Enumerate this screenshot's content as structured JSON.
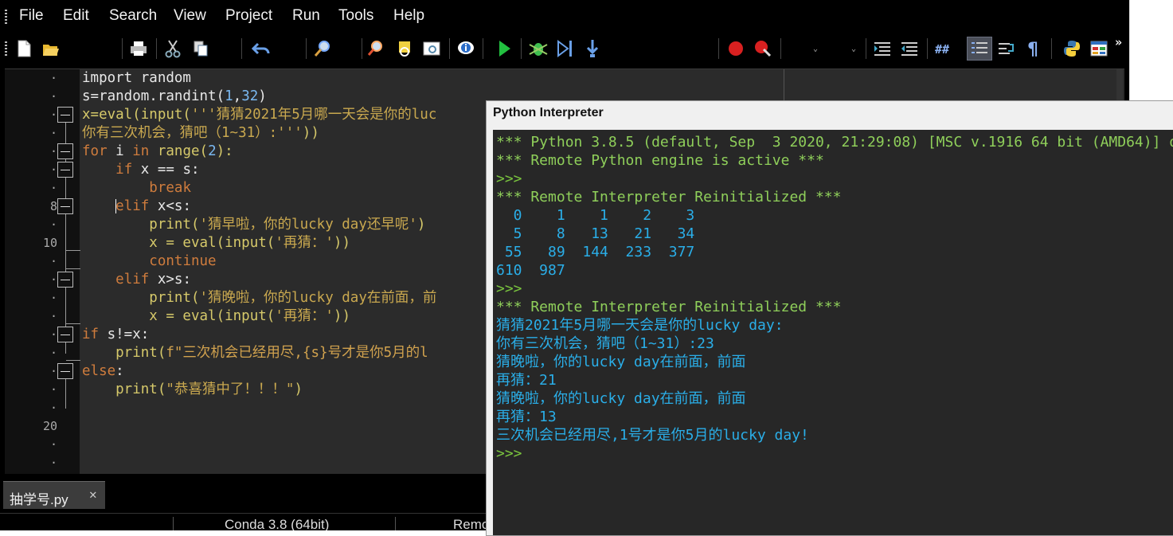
{
  "menu": [
    "File",
    "Edit",
    "Search",
    "View",
    "Project",
    "Run",
    "Tools",
    "Help"
  ],
  "toolbar": {
    "icons": [
      "new-file-icon",
      "open-file-icon",
      "print-icon",
      "cut-icon",
      "copy-icon",
      "undo-icon",
      "find-icon",
      "find-in-files-icon",
      "highlight-icon",
      "view-icon",
      "info-icon",
      "run-icon",
      "debug-icon",
      "step-icon",
      "step-into-icon",
      "breakpoint-icon",
      "clear-breakpoints-icon",
      "indent-icon",
      "dedent-icon",
      "comment-icon",
      "line-numbers-icon",
      "wrap-icon",
      "paragraph-icon",
      "python-icon",
      "layout-icon"
    ],
    "more": "»"
  },
  "editor": {
    "line_numbers": {
      "8": "8",
      "10": "10",
      "20": "20"
    },
    "code_lines": [
      [
        {
          "t": "import random",
          "c": "wht"
        }
      ],
      [
        {
          "t": "s=random.randint(",
          "c": "wht"
        },
        {
          "t": "1",
          "c": "num"
        },
        {
          "t": ",",
          "c": "wht"
        },
        {
          "t": "32",
          "c": "num"
        },
        {
          "t": ")",
          "c": "wht"
        }
      ],
      [
        {
          "t": "x=eval(input(",
          "c": "bi"
        },
        {
          "t": "'''猜猜2021年5月哪一天会是你的luc",
          "c": "str"
        }
      ],
      [
        {
          "t": "你有三次机会，猜吧（1~31）:'''",
          "c": "str"
        },
        {
          "t": "))",
          "c": "bi"
        }
      ],
      [
        {
          "t": "for",
          "c": "kw"
        },
        {
          "t": " i ",
          "c": "wht"
        },
        {
          "t": "in",
          "c": "kw"
        },
        {
          "t": " range(",
          "c": "bi"
        },
        {
          "t": "2",
          "c": "num"
        },
        {
          "t": "):",
          "c": "bi"
        }
      ],
      [
        {
          "t": "    ",
          "c": "wht"
        },
        {
          "t": "if",
          "c": "kw"
        },
        {
          "t": " x == s:",
          "c": "wht"
        }
      ],
      [
        {
          "t": "        ",
          "c": "wht"
        },
        {
          "t": "break",
          "c": "kw"
        }
      ],
      [
        {
          "t": "    ",
          "c": "wht"
        },
        {
          "t": "elif",
          "c": "kw"
        },
        {
          "t": " x<s:",
          "c": "wht"
        }
      ],
      [
        {
          "t": "        print(",
          "c": "bi"
        },
        {
          "t": "'猜早啦，你的lucky day还早呢'",
          "c": "str"
        },
        {
          "t": ")",
          "c": "bi"
        }
      ],
      [
        {
          "t": "        x = eval(input(",
          "c": "bi"
        },
        {
          "t": "'再猜：'",
          "c": "str"
        },
        {
          "t": "))",
          "c": "bi"
        }
      ],
      [
        {
          "t": "        ",
          "c": "wht"
        },
        {
          "t": "continue",
          "c": "kw"
        }
      ],
      [
        {
          "t": "    ",
          "c": "wht"
        },
        {
          "t": "elif",
          "c": "kw"
        },
        {
          "t": " x>s:",
          "c": "wht"
        }
      ],
      [
        {
          "t": "        print(",
          "c": "bi"
        },
        {
          "t": "'猜晚啦，你的lucky day在前面，前",
          "c": "str"
        }
      ],
      [
        {
          "t": "        x = eval(input(",
          "c": "bi"
        },
        {
          "t": "'再猜：'",
          "c": "str"
        },
        {
          "t": "))",
          "c": "bi"
        }
      ],
      [
        {
          "t": "if",
          "c": "kw"
        },
        {
          "t": " s!=x:",
          "c": "wht"
        }
      ],
      [
        {
          "t": "    print(",
          "c": "bi"
        },
        {
          "t": "f\"三次机会已经用尽,{s}号才是你5月的l",
          "c": "fstr"
        }
      ],
      [
        {
          "t": "else",
          "c": "kw"
        },
        {
          "t": ":",
          "c": "wht"
        }
      ],
      [
        {
          "t": "    print(",
          "c": "bi"
        },
        {
          "t": "\"恭喜猜中了！！！\"",
          "c": "str"
        },
        {
          "t": ")",
          "c": "bi"
        }
      ]
    ]
  },
  "tab": {
    "label": "抽学号.py",
    "close": "✕"
  },
  "status": {
    "interpreter": "Conda 3.8 (64bit)",
    "remote": "Remo"
  },
  "interpreter": {
    "title": "Python Interpreter",
    "lines": [
      {
        "t": "*** Python 3.8.5 (default, Sep  3 2020, 21:29:08) [MSC v.1916 64 bit (AMD64)] o",
        "c": "ig"
      },
      {
        "t": "*** Remote Python engine is active ***",
        "c": "ig"
      },
      {
        "t": ">>>",
        "c": "iy"
      },
      {
        "t": "*** Remote Interpreter Reinitialized ***",
        "c": "ig"
      },
      {
        "t": "  0    1    1    2    3",
        "c": "ib"
      },
      {
        "t": "  5    8   13   21   34",
        "c": "ib"
      },
      {
        "t": " 55   89  144  233  377",
        "c": "ib"
      },
      {
        "t": "610  987",
        "c": "ib"
      },
      {
        "t": ">>>",
        "c": "iy"
      },
      {
        "t": "*** Remote Interpreter Reinitialized ***",
        "c": "ig"
      },
      {
        "t": "猜猜2021年5月哪一天会是你的lucky day:",
        "c": "ic"
      },
      {
        "t": "你有三次机会，猜吧（1~31）:23",
        "c": "ic"
      },
      {
        "t": "猜晚啦，你的lucky day在前面，前面",
        "c": "ic"
      },
      {
        "t": "再猜：21",
        "c": "ic"
      },
      {
        "t": "猜晚啦，你的lucky day在前面，前面",
        "c": "ic"
      },
      {
        "t": "再猜：13",
        "c": "ic"
      },
      {
        "t": "三次机会已经用尽,1号才是你5月的lucky day!",
        "c": "ic"
      },
      {
        "t": ">>>",
        "c": "iy"
      }
    ]
  }
}
